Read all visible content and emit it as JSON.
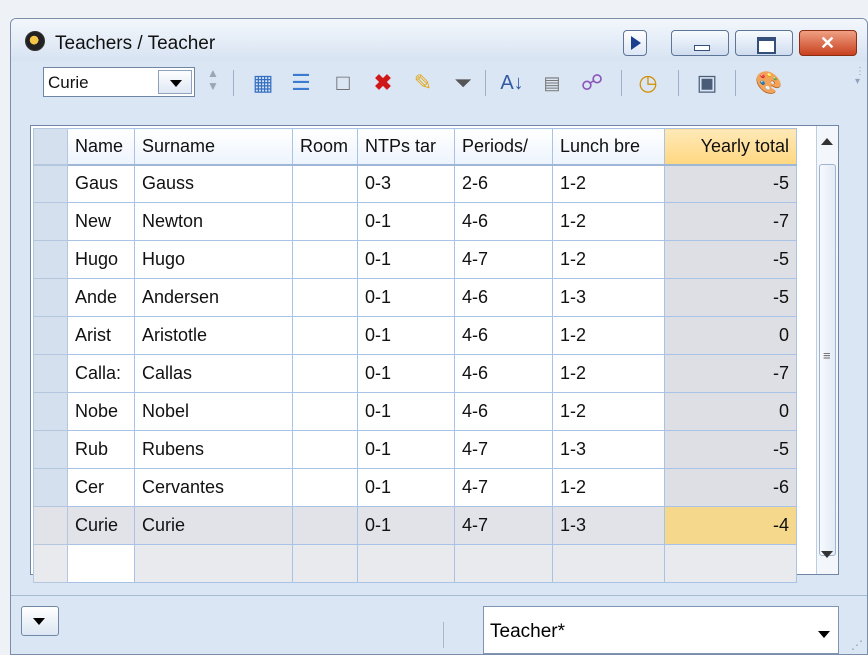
{
  "window": {
    "title": "Teachers / Teacher"
  },
  "toolbar": {
    "selected_teacher": "Curie",
    "icons": [
      "spin-up-icon",
      "spin-down-icon",
      "grid-icon",
      "list-icon",
      "new-item-icon",
      "delete-icon",
      "edit-icon",
      "filter-icon",
      "sort-icon",
      "matrix-icon",
      "connect-icon",
      "clock-icon",
      "calendar-icon",
      "palette-icon"
    ]
  },
  "grid": {
    "columns": [
      "Name",
      "Surname",
      "Room",
      "NTPs tar",
      "Periods/",
      "Lunch bre",
      "Yearly total"
    ],
    "rows": [
      [
        "Gaus",
        "Gauss",
        "",
        "0-3",
        "2-6",
        "1-2",
        "-5"
      ],
      [
        "New",
        "Newton",
        "",
        "0-1",
        "4-6",
        "1-2",
        "-7"
      ],
      [
        "Hugo",
        "Hugo",
        "",
        "0-1",
        "4-7",
        "1-2",
        "-5"
      ],
      [
        "Ande",
        "Andersen",
        "",
        "0-1",
        "4-6",
        "1-3",
        "-5"
      ],
      [
        "Arist",
        "Aristotle",
        "",
        "0-1",
        "4-6",
        "1-2",
        "0"
      ],
      [
        "Calla:",
        "Callas",
        "",
        "0-1",
        "4-6",
        "1-2",
        "-7"
      ],
      [
        "Nobe",
        "Nobel",
        "",
        "0-1",
        "4-6",
        "1-2",
        "0"
      ],
      [
        "Rub",
        "Rubens",
        "",
        "0-1",
        "4-7",
        "1-3",
        "-5"
      ],
      [
        "Cer",
        "Cervantes",
        "",
        "0-1",
        "4-7",
        "1-2",
        "-6"
      ],
      [
        "Curie",
        "Curie",
        "",
        "0-1",
        "4-7",
        "1-3",
        "-4"
      ]
    ],
    "selected_row": 9
  },
  "statusbar": {
    "view": "Teacher*"
  },
  "colors": {
    "selected_cell": "#f6d88c",
    "header_highlight": "#ffd780",
    "grid_line": "#a9c3e6"
  }
}
